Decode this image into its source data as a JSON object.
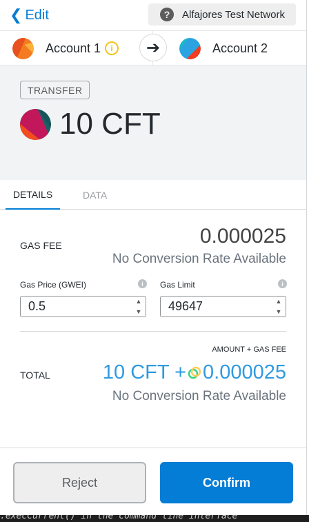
{
  "header": {
    "back_label": "Edit",
    "network_label": "Alfajores Test Network"
  },
  "accounts": {
    "from_name": "Account 1",
    "to_name": "Account 2"
  },
  "summary": {
    "action_label": "TRANSFER",
    "amount": "10 CFT"
  },
  "tabs": [
    {
      "label": "DETAILS",
      "active": true
    },
    {
      "label": "DATA",
      "active": false
    }
  ],
  "details": {
    "gas_fee_label": "GAS FEE",
    "gas_fee_value": "0.000025",
    "gas_fee_conversion": "No Conversion Rate Available",
    "gas_price_label": "Gas Price (GWEI)",
    "gas_price_value": "0.5",
    "gas_limit_label": "Gas Limit",
    "gas_limit_value": "49647",
    "total_sublabel": "AMOUNT + GAS FEE",
    "total_label": "TOTAL",
    "total_amount_part": "10 CFT +",
    "total_fee_part": "0.000025",
    "total_conversion": "No Conversion Rate Available"
  },
  "footer": {
    "reject_label": "Reject",
    "confirm_label": "Confirm"
  },
  "background_terminal_text": ".execCurrent() in the command line interface",
  "colors": {
    "accent": "#037dd6",
    "total_value": "#2f9ae0",
    "summary_bg": "#f2f3f4"
  },
  "icons": {
    "back": "chevron-left-icon",
    "network_help": "question-circle-icon",
    "from_info": "info-circle-icon",
    "direction": "arrow-right-icon",
    "fee_coin": "celo-coin-icon"
  }
}
